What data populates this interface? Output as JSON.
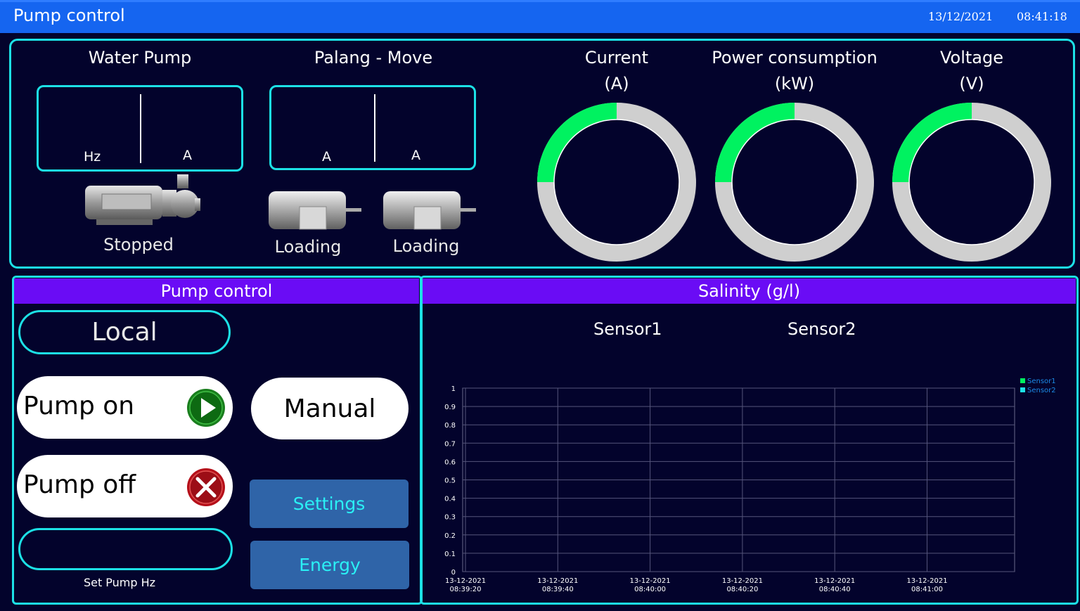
{
  "header": {
    "title": "Pump control",
    "date": "13/12/2021",
    "time": "08:41:18"
  },
  "water_pump": {
    "title": "Water Pump",
    "unit_left": "Hz",
    "unit_right": "A",
    "status": "Stopped"
  },
  "palang": {
    "title": "Palang - Move",
    "unit_left": "A",
    "unit_right": "A",
    "status_left": "Loading",
    "status_right": "Loading"
  },
  "gauges": [
    {
      "title": "Current",
      "unit": "(A)"
    },
    {
      "title": "Power consumption",
      "unit": "(kW)"
    },
    {
      "title": "Voltage",
      "unit": "(V)"
    }
  ],
  "pump_control": {
    "header": "Pump control",
    "mode_label": "Local",
    "pump_on_label": "Pump on",
    "pump_off_label": "Pump off",
    "manual_label": "Manual",
    "settings_label": "Settings",
    "energy_label": "Energy",
    "set_hz_value": "",
    "set_hz_label": "Set Pump Hz"
  },
  "salinity": {
    "header": "Salinity (g/l)",
    "sensor1_label": "Sensor1",
    "sensor2_label": "Sensor2"
  },
  "colors": {
    "gauge_fill": "#00f260",
    "gauge_track": "#cfcfcf",
    "accent_cyan": "#1ce1e6",
    "header_purple": "#6a0cf5",
    "sensor1": "#00f260",
    "sensor2": "#1ce1e6"
  },
  "chart_data": {
    "type": "line",
    "ylim": [
      0,
      1
    ],
    "y_ticks": [
      "0",
      "0.1",
      "0.2",
      "0.3",
      "0.4",
      "0.5",
      "0.6",
      "0.7",
      "0.8",
      "0.9",
      "1"
    ],
    "x_ticks": [
      {
        "date": "13-12-2021",
        "time": "08:39:20"
      },
      {
        "date": "13-12-2021",
        "time": "08:39:40"
      },
      {
        "date": "13-12-2021",
        "time": "08:40:00"
      },
      {
        "date": "13-12-2021",
        "time": "08:40:20"
      },
      {
        "date": "13-12-2021",
        "time": "08:40:40"
      },
      {
        "date": "13-12-2021",
        "time": "08:41:00"
      }
    ],
    "grid": true,
    "legend_position": "top-right",
    "series": [
      {
        "name": "Sensor1",
        "values": []
      },
      {
        "name": "Sensor2",
        "values": []
      }
    ]
  }
}
